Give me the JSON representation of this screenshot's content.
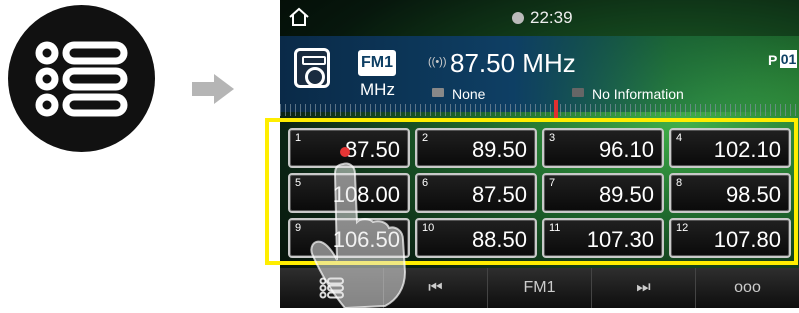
{
  "left_icon": {
    "name": "list-menu-icon"
  },
  "arrow": {
    "name": "arrow-right-icon"
  },
  "topbar": {
    "time": "22:39"
  },
  "info": {
    "band": "FM1",
    "unit": "MHz",
    "frequency": "87.50 MHz",
    "program": "None",
    "info_text": "No Information",
    "preset_label": "P",
    "preset_number": "01"
  },
  "presets": [
    {
      "num": "1",
      "value": "87.50"
    },
    {
      "num": "2",
      "value": "89.50"
    },
    {
      "num": "3",
      "value": "96.10"
    },
    {
      "num": "4",
      "value": "102.10"
    },
    {
      "num": "5",
      "value": "108.00"
    },
    {
      "num": "6",
      "value": "87.50"
    },
    {
      "num": "7",
      "value": "89.50"
    },
    {
      "num": "8",
      "value": "98.50"
    },
    {
      "num": "9",
      "value": "106.50"
    },
    {
      "num": "10",
      "value": "88.50"
    },
    {
      "num": "11",
      "value": "107.30"
    },
    {
      "num": "12",
      "value": "107.80"
    }
  ],
  "bottombar": {
    "prev": "⏮",
    "band": "FM1",
    "next": "⏭",
    "more": "ooo"
  },
  "colors": {
    "highlight": "#ffee00",
    "touch": "#e53535"
  }
}
